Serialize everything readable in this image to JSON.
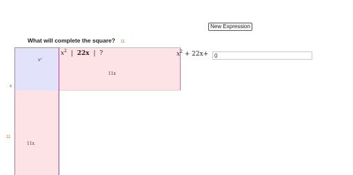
{
  "toolbar": {
    "new_expression_label": "New Expression"
  },
  "prompt": {
    "question": "What will complete the square?",
    "badge": "11"
  },
  "diagram": {
    "term_x2": "x",
    "term_x2_exp": "2",
    "term_sep": "|",
    "term_bx": "22x",
    "term_unknown": "?",
    "cell_x2": "x²",
    "cell_top": "11x",
    "cell_left": "11x",
    "side_x": "x",
    "side_11": "11"
  },
  "expression": {
    "x": "x",
    "exp": "2",
    "rest": "+ 22x+",
    "answer_value": "0"
  },
  "colors": {
    "blue_region": "#e2e2fb",
    "pink_region": "#fde3e6",
    "divider": "#c0408a",
    "accent_orange": "#d46a1a"
  }
}
